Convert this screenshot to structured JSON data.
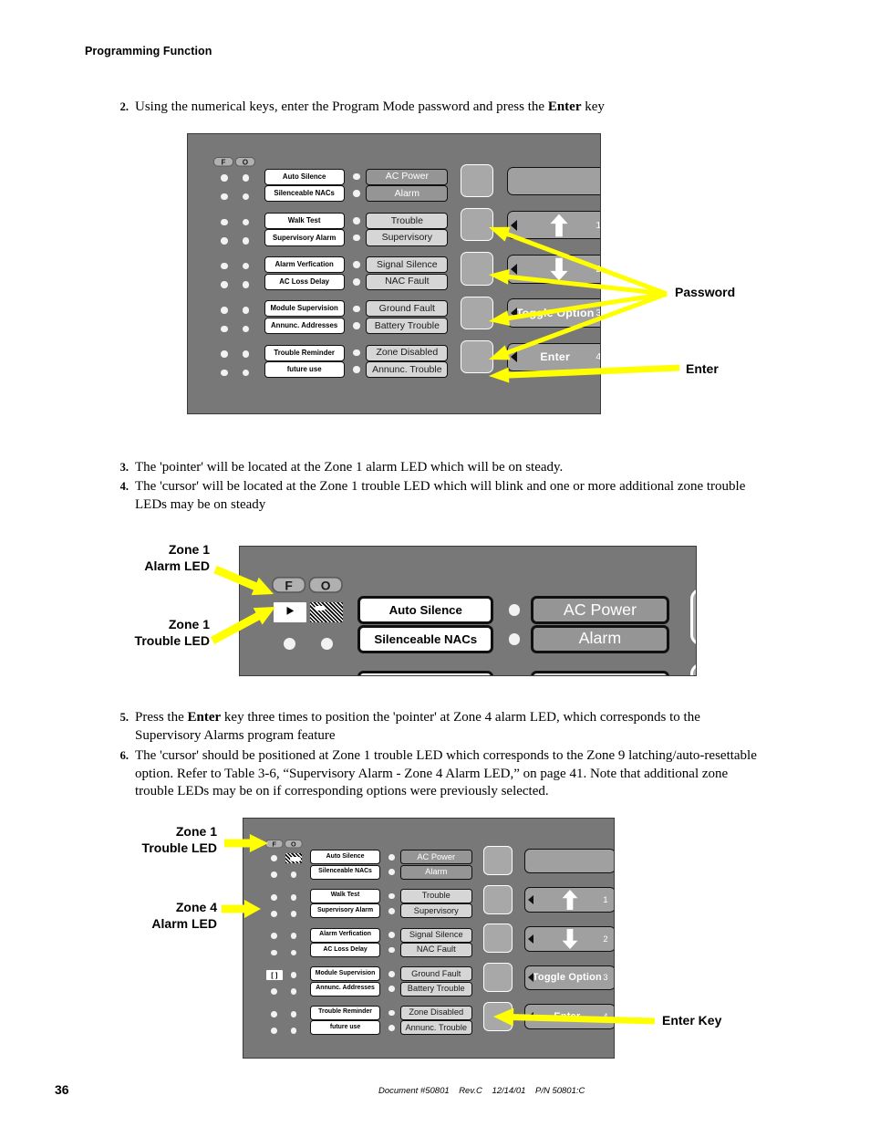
{
  "header": {
    "title": "Programming Function"
  },
  "footer": {
    "page_number": "36",
    "document_info": "Document #50801    Rev.C    12/14/01    P/N 50801:C"
  },
  "steps": [
    {
      "number": "2.",
      "parts": [
        "Using the numerical keys, enter the Program Mode password and press the ",
        "Enter",
        " key"
      ]
    },
    {
      "number": "3.",
      "text": "The 'pointer' will be located at the Zone 1 alarm LED which will be on steady."
    },
    {
      "number": "4.",
      "text": "The 'cursor' will be located at the Zone 1 trouble LED which will blink and one or more additional zone trouble LEDs may be on steady"
    },
    {
      "number": "5.",
      "parts": [
        "Press the ",
        "Enter",
        " key three times to position the 'pointer' at Zone 4 alarm LED, which corresponds to the Supervisory Alarms program feature"
      ]
    },
    {
      "number": "6.",
      "text": "The 'cursor' should be positioned at Zone 1 trouble LED which corresponds to the Zone 9 latching/auto-resettable option.  Refer to Table 3-6, “Supervisory Alarm - Zone 4 Alarm LED,” on page 41.  Note that additional zone trouble LEDs may be on if corresponding options were previously selected."
    }
  ],
  "panel": {
    "led_columns": [
      "F",
      "O"
    ],
    "left_labels": [
      "Auto Silence",
      "Silenceable NACs",
      "Walk Test",
      "Supervisory Alarm",
      "Alarm Verfication",
      "AC Loss Delay",
      "Module Supervision",
      "Annunc. Addresses",
      "Trouble Reminder",
      "future use"
    ],
    "right_labels": [
      {
        "text": "AC Power",
        "style": "dark"
      },
      {
        "text": "Alarm",
        "style": "dark"
      },
      {
        "text": "Trouble",
        "style": "light"
      },
      {
        "text": "Supervisory",
        "style": "light"
      },
      {
        "text": "Signal Silence",
        "style": "light"
      },
      {
        "text": "NAC Fault",
        "style": "light"
      },
      {
        "text": "Ground Fault",
        "style": "light"
      },
      {
        "text": "Battery Trouble",
        "style": "light"
      },
      {
        "text": "Zone Disabled",
        "style": "light"
      },
      {
        "text": "Annunc. Trouble",
        "style": "light"
      }
    ],
    "keys": [
      {
        "label": "",
        "number": "",
        "icon": "blank",
        "arrow": false
      },
      {
        "label": "",
        "number": "1",
        "icon": "up-arrow-icon",
        "arrow": true
      },
      {
        "label": "",
        "number": "2",
        "icon": "down-arrow-icon",
        "arrow": true
      },
      {
        "label": "Toggle Option",
        "number": "3",
        "icon": "none",
        "arrow": true
      },
      {
        "label": "Enter",
        "number": "4",
        "icon": "none",
        "arrow": true
      }
    ]
  },
  "figures": {
    "figure1": {
      "callouts": [
        {
          "name": "password",
          "text": "Password"
        },
        {
          "name": "enter",
          "text": "Enter"
        }
      ]
    },
    "figure2": {
      "callouts": [
        {
          "name": "zone1-alarm-led",
          "text": "Zone 1\nAlarm LED"
        },
        {
          "name": "zone1-trouble-led",
          "text": "Zone 1\nTrouble LED"
        }
      ],
      "indicators": {
        "zone1_alarm": "pointer",
        "zone1_trouble": "blink"
      }
    },
    "figure3": {
      "callouts": [
        {
          "name": "zone1-trouble-led",
          "text": "Zone 1\nTrouble LED"
        },
        {
          "name": "zone4-alarm-led",
          "text": "Zone 4\nAlarm LED"
        },
        {
          "name": "enter-key",
          "text": "Enter Key"
        }
      ],
      "indicators": {
        "zone1_trouble": "blink",
        "zone4_alarm": "cursor"
      },
      "cursor_glyph": "[ ]",
      "pointer_glyph": "⯈"
    }
  },
  "colors": {
    "panel_bg": "#787878",
    "callout_arrow": "#ffff00",
    "label_white": "#ffffff",
    "label_gray_dark": "#959595",
    "label_gray_light": "#d6d6d6",
    "key_face": "#a0a0a0"
  }
}
